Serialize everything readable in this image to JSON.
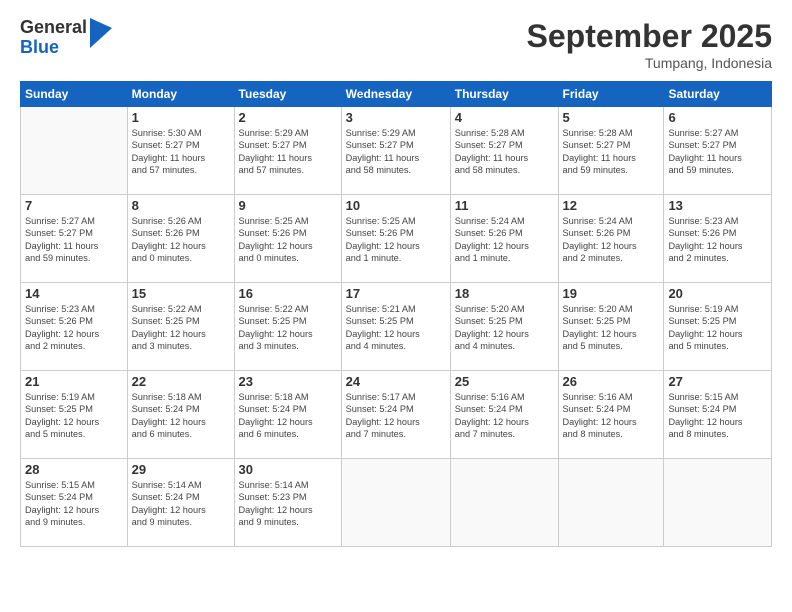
{
  "logo": {
    "general": "General",
    "blue": "Blue"
  },
  "title": "September 2025",
  "location": "Tumpang, Indonesia",
  "days": [
    "Sunday",
    "Monday",
    "Tuesday",
    "Wednesday",
    "Thursday",
    "Friday",
    "Saturday"
  ],
  "weeks": [
    [
      {
        "day": "",
        "info": ""
      },
      {
        "day": "1",
        "info": "Sunrise: 5:30 AM\nSunset: 5:27 PM\nDaylight: 11 hours\nand 57 minutes."
      },
      {
        "day": "2",
        "info": "Sunrise: 5:29 AM\nSunset: 5:27 PM\nDaylight: 11 hours\nand 57 minutes."
      },
      {
        "day": "3",
        "info": "Sunrise: 5:29 AM\nSunset: 5:27 PM\nDaylight: 11 hours\nand 58 minutes."
      },
      {
        "day": "4",
        "info": "Sunrise: 5:28 AM\nSunset: 5:27 PM\nDaylight: 11 hours\nand 58 minutes."
      },
      {
        "day": "5",
        "info": "Sunrise: 5:28 AM\nSunset: 5:27 PM\nDaylight: 11 hours\nand 59 minutes."
      },
      {
        "day": "6",
        "info": "Sunrise: 5:27 AM\nSunset: 5:27 PM\nDaylight: 11 hours\nand 59 minutes."
      }
    ],
    [
      {
        "day": "7",
        "info": "Sunrise: 5:27 AM\nSunset: 5:27 PM\nDaylight: 11 hours\nand 59 minutes."
      },
      {
        "day": "8",
        "info": "Sunrise: 5:26 AM\nSunset: 5:26 PM\nDaylight: 12 hours\nand 0 minutes."
      },
      {
        "day": "9",
        "info": "Sunrise: 5:25 AM\nSunset: 5:26 PM\nDaylight: 12 hours\nand 0 minutes."
      },
      {
        "day": "10",
        "info": "Sunrise: 5:25 AM\nSunset: 5:26 PM\nDaylight: 12 hours\nand 1 minute."
      },
      {
        "day": "11",
        "info": "Sunrise: 5:24 AM\nSunset: 5:26 PM\nDaylight: 12 hours\nand 1 minute."
      },
      {
        "day": "12",
        "info": "Sunrise: 5:24 AM\nSunset: 5:26 PM\nDaylight: 12 hours\nand 2 minutes."
      },
      {
        "day": "13",
        "info": "Sunrise: 5:23 AM\nSunset: 5:26 PM\nDaylight: 12 hours\nand 2 minutes."
      }
    ],
    [
      {
        "day": "14",
        "info": "Sunrise: 5:23 AM\nSunset: 5:26 PM\nDaylight: 12 hours\nand 2 minutes."
      },
      {
        "day": "15",
        "info": "Sunrise: 5:22 AM\nSunset: 5:25 PM\nDaylight: 12 hours\nand 3 minutes."
      },
      {
        "day": "16",
        "info": "Sunrise: 5:22 AM\nSunset: 5:25 PM\nDaylight: 12 hours\nand 3 minutes."
      },
      {
        "day": "17",
        "info": "Sunrise: 5:21 AM\nSunset: 5:25 PM\nDaylight: 12 hours\nand 4 minutes."
      },
      {
        "day": "18",
        "info": "Sunrise: 5:20 AM\nSunset: 5:25 PM\nDaylight: 12 hours\nand 4 minutes."
      },
      {
        "day": "19",
        "info": "Sunrise: 5:20 AM\nSunset: 5:25 PM\nDaylight: 12 hours\nand 5 minutes."
      },
      {
        "day": "20",
        "info": "Sunrise: 5:19 AM\nSunset: 5:25 PM\nDaylight: 12 hours\nand 5 minutes."
      }
    ],
    [
      {
        "day": "21",
        "info": "Sunrise: 5:19 AM\nSunset: 5:25 PM\nDaylight: 12 hours\nand 5 minutes."
      },
      {
        "day": "22",
        "info": "Sunrise: 5:18 AM\nSunset: 5:24 PM\nDaylight: 12 hours\nand 6 minutes."
      },
      {
        "day": "23",
        "info": "Sunrise: 5:18 AM\nSunset: 5:24 PM\nDaylight: 12 hours\nand 6 minutes."
      },
      {
        "day": "24",
        "info": "Sunrise: 5:17 AM\nSunset: 5:24 PM\nDaylight: 12 hours\nand 7 minutes."
      },
      {
        "day": "25",
        "info": "Sunrise: 5:16 AM\nSunset: 5:24 PM\nDaylight: 12 hours\nand 7 minutes."
      },
      {
        "day": "26",
        "info": "Sunrise: 5:16 AM\nSunset: 5:24 PM\nDaylight: 12 hours\nand 8 minutes."
      },
      {
        "day": "27",
        "info": "Sunrise: 5:15 AM\nSunset: 5:24 PM\nDaylight: 12 hours\nand 8 minutes."
      }
    ],
    [
      {
        "day": "28",
        "info": "Sunrise: 5:15 AM\nSunset: 5:24 PM\nDaylight: 12 hours\nand 9 minutes."
      },
      {
        "day": "29",
        "info": "Sunrise: 5:14 AM\nSunset: 5:24 PM\nDaylight: 12 hours\nand 9 minutes."
      },
      {
        "day": "30",
        "info": "Sunrise: 5:14 AM\nSunset: 5:23 PM\nDaylight: 12 hours\nand 9 minutes."
      },
      {
        "day": "",
        "info": ""
      },
      {
        "day": "",
        "info": ""
      },
      {
        "day": "",
        "info": ""
      },
      {
        "day": "",
        "info": ""
      }
    ]
  ]
}
